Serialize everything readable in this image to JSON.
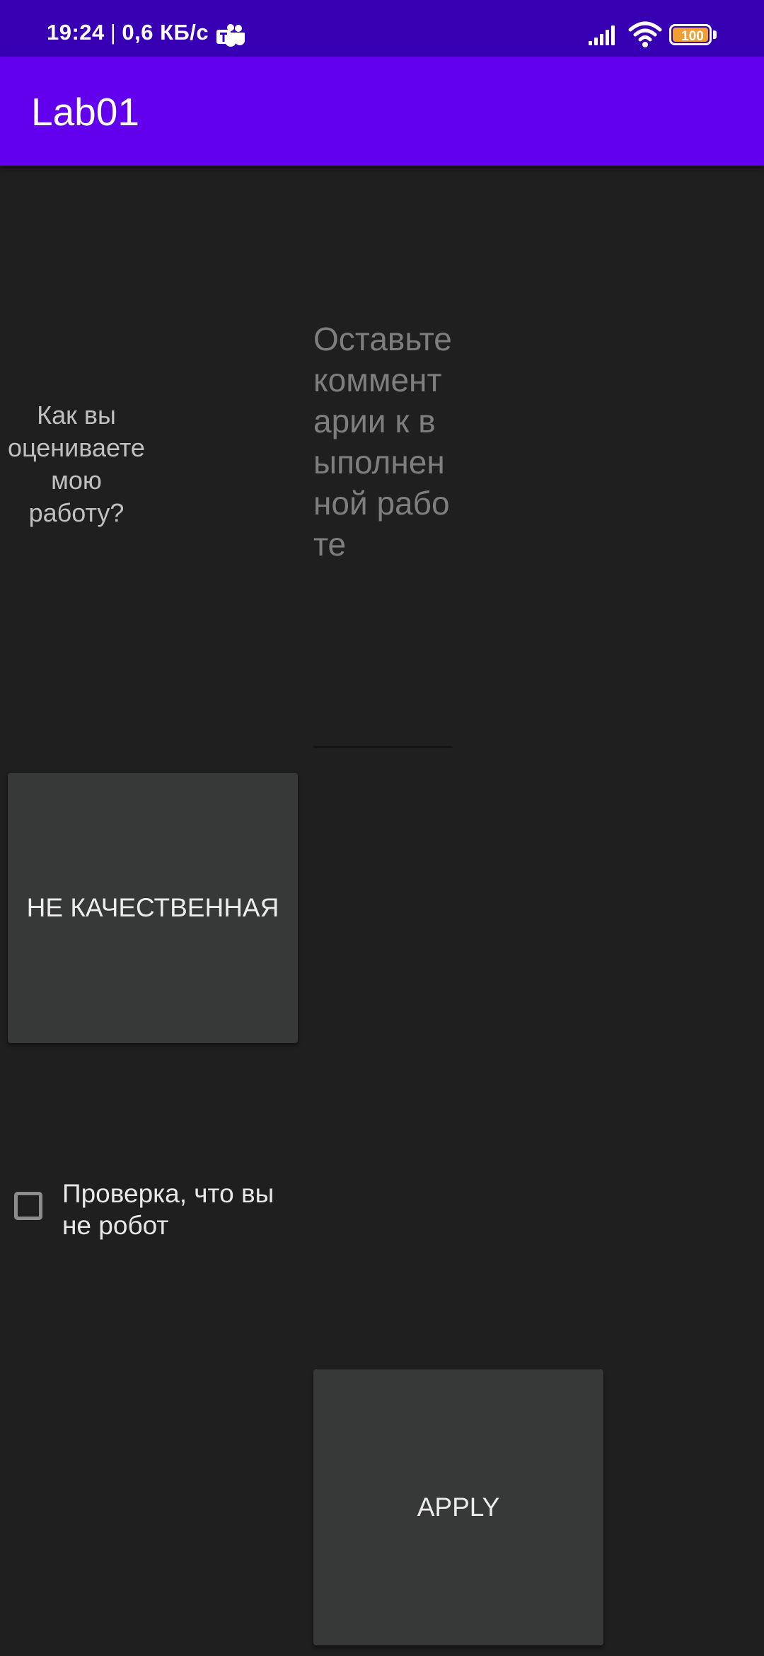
{
  "status_bar": {
    "time": "19:24",
    "separator": "|",
    "network_speed": "0,6 КБ/с",
    "battery_level": "100",
    "battery_fraction": 1.0,
    "icons": [
      "teams-icon",
      "signal-icon",
      "wifi-icon",
      "battery-icon"
    ]
  },
  "app_bar": {
    "title": "Lab01"
  },
  "main": {
    "question": "Как вы оцениваете мою работу?",
    "comment_hint": "Оставьте комментарии к выполненной работе",
    "quality_button_label": "не качественная",
    "checkbox_label": "Проверка, что вы не робот",
    "checkbox_checked": false,
    "apply_button_label": "Apply"
  },
  "colors": {
    "status_bar": "#3700b3",
    "app_bar": "#6200ee",
    "background": "#1f1f1f",
    "button": "#373838"
  }
}
